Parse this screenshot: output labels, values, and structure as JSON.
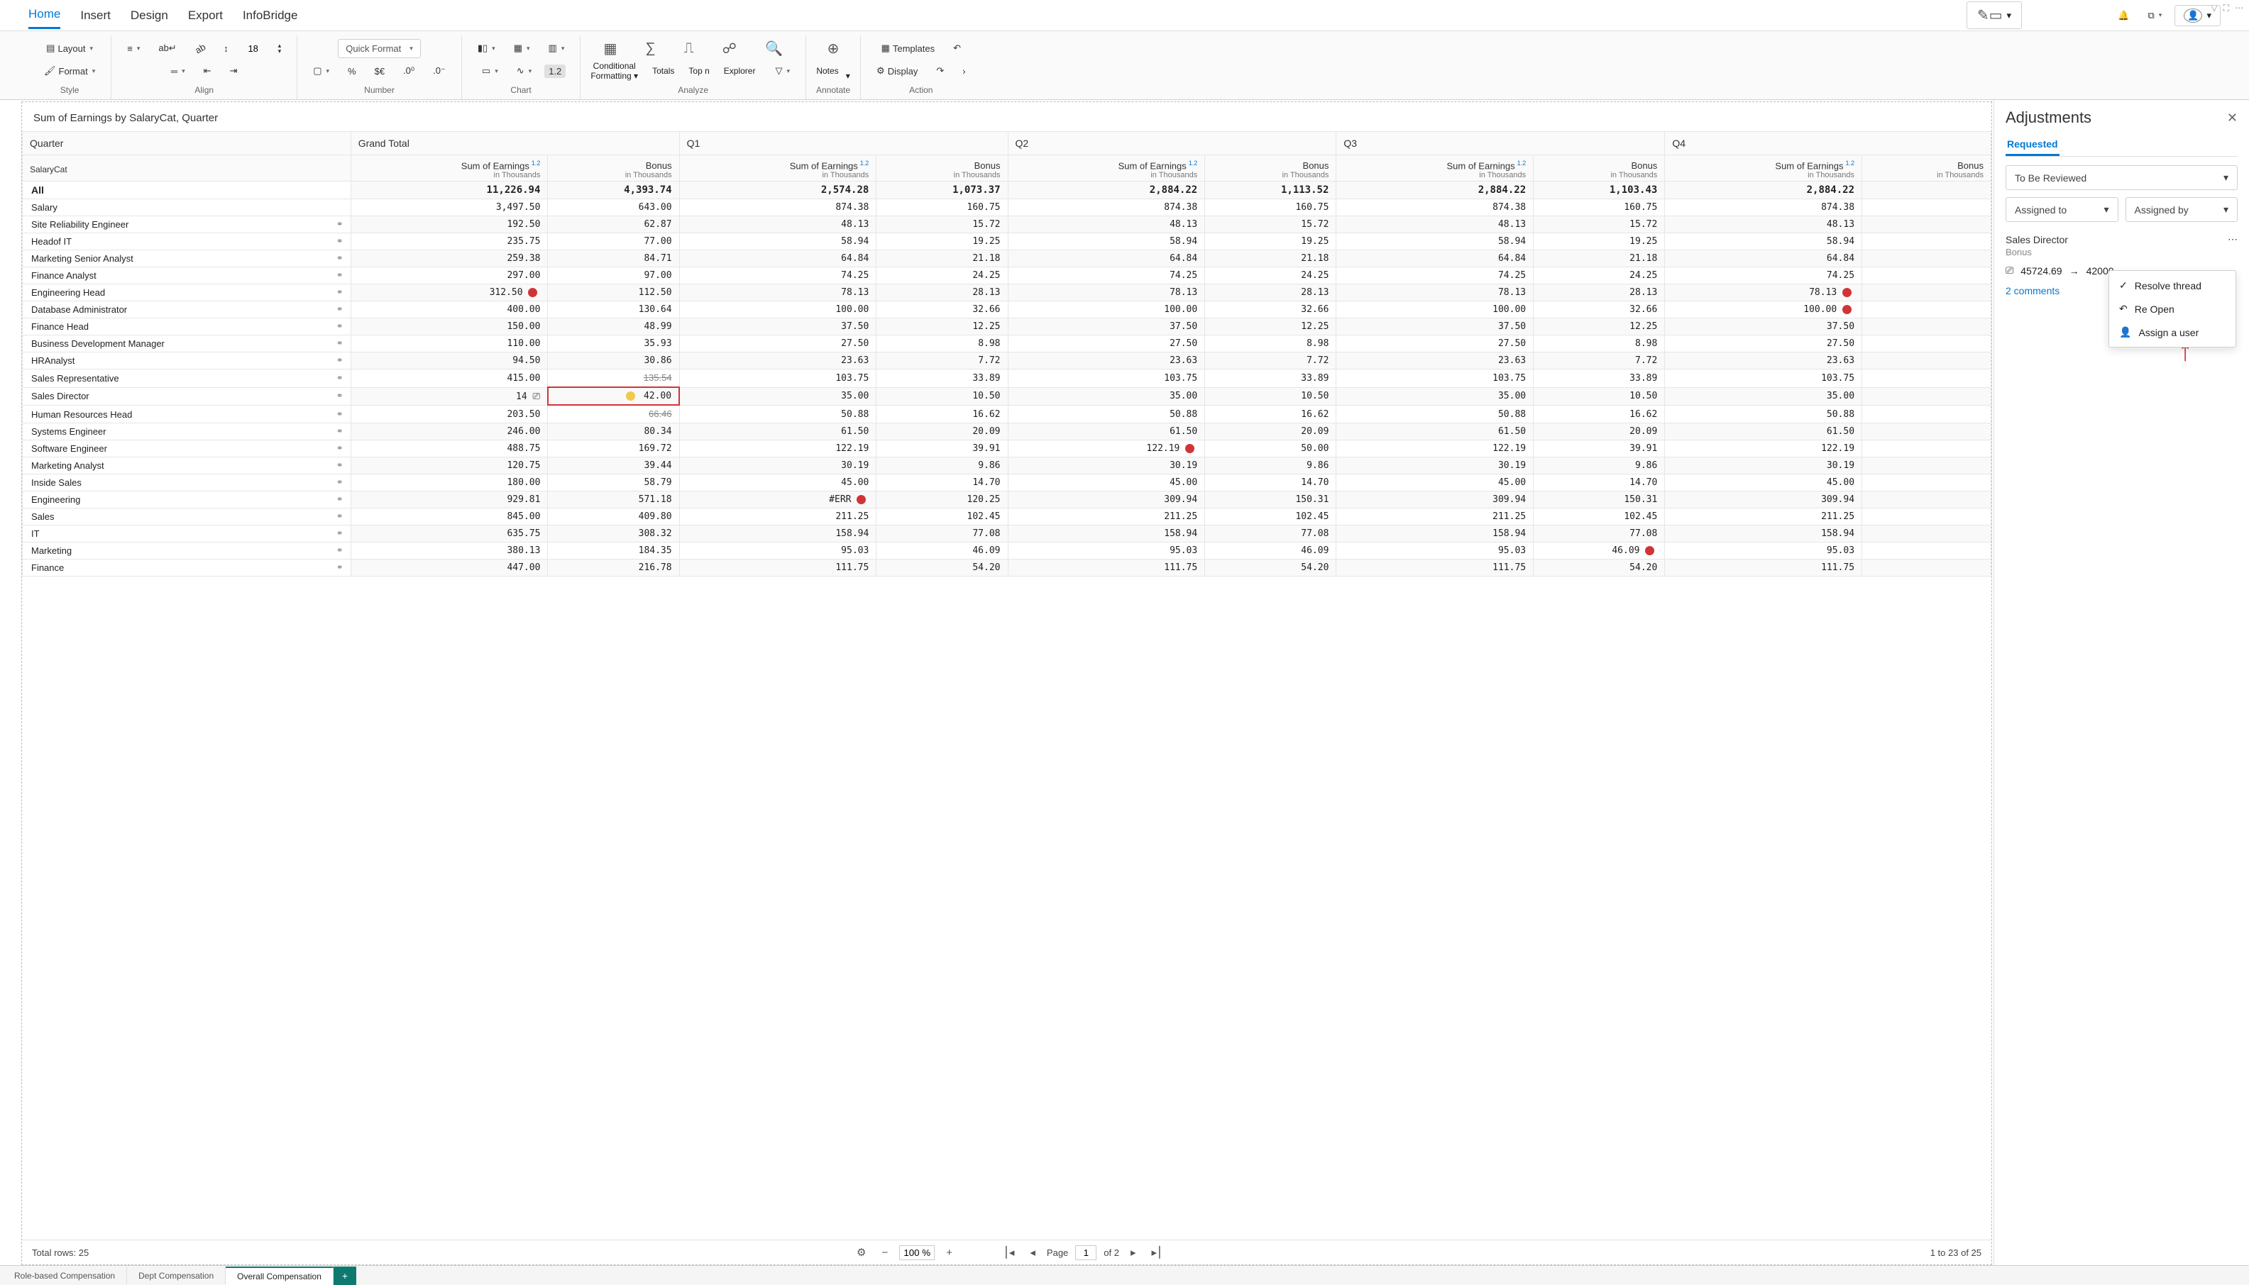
{
  "menu": {
    "items": [
      "Home",
      "Insert",
      "Design",
      "Export",
      "InfoBridge"
    ],
    "active": 0
  },
  "ribbon": {
    "style": {
      "layout": "Layout",
      "format": "Format",
      "label": "Style"
    },
    "align": {
      "fontsize": "18",
      "label": "Align"
    },
    "number": {
      "quickformat": "Quick Format",
      "label": "Number",
      "pct": "%",
      "cur": "$€",
      "d0": ".0⁰",
      "d1": ".0⁻"
    },
    "chart": {
      "label": "Chart",
      "scale": "1.2"
    },
    "analyze": {
      "cond": "Conditional",
      "cond2": "Formatting",
      "totals": "Totals",
      "topn": "Top n",
      "explorer": "Explorer",
      "label": "Analyze"
    },
    "annotate": {
      "notes": "Notes",
      "label": "Annotate"
    },
    "templates": "Templates",
    "display": "Display",
    "actions": "Action"
  },
  "report": {
    "title": "Sum of Earnings by SalaryCat, Quarter",
    "col_quarter": "Quarter",
    "col_cat": "SalaryCat",
    "col_grand": "Grand Total",
    "quarters": [
      "Q1",
      "Q2",
      "Q3",
      "Q4"
    ],
    "sub_earn": "Sum of Earnings",
    "sub_bonus": "Bonus",
    "sub_unit": "in Thousands",
    "sup": "1.2",
    "all_label": "All",
    "rows": [
      {
        "cat": "Salary",
        "link": false,
        "e": "3,497.50",
        "b": "643.00",
        "q": [
          [
            "874.38",
            "160.75"
          ],
          [
            "874.38",
            "160.75"
          ],
          [
            "874.38",
            "160.75"
          ],
          [
            "874.38",
            ""
          ]
        ]
      },
      {
        "cat": "Site Reliability Engineer",
        "link": true,
        "e": "192.50",
        "b": "62.87",
        "q": [
          [
            "48.13",
            "15.72"
          ],
          [
            "48.13",
            "15.72"
          ],
          [
            "48.13",
            "15.72"
          ],
          [
            "48.13",
            ""
          ]
        ]
      },
      {
        "cat": "Headof IT",
        "link": true,
        "e": "235.75",
        "b": "77.00",
        "q": [
          [
            "58.94",
            "19.25"
          ],
          [
            "58.94",
            "19.25"
          ],
          [
            "58.94",
            "19.25"
          ],
          [
            "58.94",
            ""
          ]
        ]
      },
      {
        "cat": "Marketing Senior Analyst",
        "link": true,
        "e": "259.38",
        "b": "84.71",
        "q": [
          [
            "64.84",
            "21.18"
          ],
          [
            "64.84",
            "21.18"
          ],
          [
            "64.84",
            "21.18"
          ],
          [
            "64.84",
            ""
          ]
        ]
      },
      {
        "cat": "Finance Analyst",
        "link": true,
        "e": "297.00",
        "b": "97.00",
        "q": [
          [
            "74.25",
            "24.25"
          ],
          [
            "74.25",
            "24.25"
          ],
          [
            "74.25",
            "24.25"
          ],
          [
            "74.25",
            ""
          ]
        ]
      },
      {
        "cat": "Engineering Head",
        "link": true,
        "e": "312.50",
        "b": "112.50",
        "dotE": "red",
        "q": [
          [
            "78.13",
            "28.13"
          ],
          [
            "78.13",
            "28.13"
          ],
          [
            "78.13",
            "28.13"
          ],
          [
            "78.13",
            ""
          ]
        ],
        "dotQ4": "red"
      },
      {
        "cat": "Database Administrator",
        "link": true,
        "e": "400.00",
        "b": "130.64",
        "q": [
          [
            "100.00",
            "32.66"
          ],
          [
            "100.00",
            "32.66"
          ],
          [
            "100.00",
            "32.66"
          ],
          [
            "100.00",
            ""
          ]
        ],
        "dotQ4": "red"
      },
      {
        "cat": "Finance Head",
        "link": true,
        "e": "150.00",
        "b": "48.99",
        "q": [
          [
            "37.50",
            "12.25"
          ],
          [
            "37.50",
            "12.25"
          ],
          [
            "37.50",
            "12.25"
          ],
          [
            "37.50",
            ""
          ]
        ]
      },
      {
        "cat": "Business Development Manager",
        "link": true,
        "e": "110.00",
        "b": "35.93",
        "q": [
          [
            "27.50",
            "8.98"
          ],
          [
            "27.50",
            "8.98"
          ],
          [
            "27.50",
            "8.98"
          ],
          [
            "27.50",
            ""
          ]
        ]
      },
      {
        "cat": "HRAnalyst",
        "link": true,
        "e": "94.50",
        "b": "30.86",
        "q": [
          [
            "23.63",
            "7.72"
          ],
          [
            "23.63",
            "7.72"
          ],
          [
            "23.63",
            "7.72"
          ],
          [
            "23.63",
            ""
          ]
        ]
      },
      {
        "cat": "Sales Representative",
        "link": true,
        "e": "415.00",
        "b": "135.54",
        "bStrike": true,
        "q": [
          [
            "103.75",
            "33.89"
          ],
          [
            "103.75",
            "33.89"
          ],
          [
            "103.75",
            "33.89"
          ],
          [
            "103.75",
            ""
          ]
        ]
      },
      {
        "cat": "Sales Director",
        "link": true,
        "e": "14",
        "eIcon": true,
        "b": "42.00",
        "bHighlight": true,
        "dotB": "yellow",
        "q": [
          [
            "35.00",
            "10.50"
          ],
          [
            "35.00",
            "10.50"
          ],
          [
            "35.00",
            "10.50"
          ],
          [
            "35.00",
            ""
          ]
        ]
      },
      {
        "cat": "Human Resources Head",
        "link": true,
        "e": "203.50",
        "b": "66.46",
        "bStrike": true,
        "q": [
          [
            "50.88",
            "16.62"
          ],
          [
            "50.88",
            "16.62"
          ],
          [
            "50.88",
            "16.62"
          ],
          [
            "50.88",
            ""
          ]
        ]
      },
      {
        "cat": "Systems Engineer",
        "link": true,
        "e": "246.00",
        "b": "80.34",
        "q": [
          [
            "61.50",
            "20.09"
          ],
          [
            "61.50",
            "20.09"
          ],
          [
            "61.50",
            "20.09"
          ],
          [
            "61.50",
            ""
          ]
        ]
      },
      {
        "cat": "Software Engineer",
        "link": true,
        "e": "488.75",
        "b": "169.72",
        "q": [
          [
            "122.19",
            "39.91"
          ],
          [
            "122.19",
            "50.00"
          ],
          [
            "122.19",
            "39.91"
          ],
          [
            "122.19",
            ""
          ]
        ],
        "dot_q2e": "red"
      },
      {
        "cat": "Marketing Analyst",
        "link": true,
        "e": "120.75",
        "b": "39.44",
        "q": [
          [
            "30.19",
            "9.86"
          ],
          [
            "30.19",
            "9.86"
          ],
          [
            "30.19",
            "9.86"
          ],
          [
            "30.19",
            ""
          ]
        ]
      },
      {
        "cat": "Inside Sales",
        "link": true,
        "e": "180.00",
        "b": "58.79",
        "q": [
          [
            "45.00",
            "14.70"
          ],
          [
            "45.00",
            "14.70"
          ],
          [
            "45.00",
            "14.70"
          ],
          [
            "45.00",
            ""
          ]
        ]
      },
      {
        "cat": "Engineering",
        "link": true,
        "e": "929.81",
        "b": "571.18",
        "q": [
          [
            "#ERR",
            "120.25"
          ],
          [
            "309.94",
            "150.31"
          ],
          [
            "309.94",
            "150.31"
          ],
          [
            "309.94",
            ""
          ]
        ],
        "dot_q1e": "red"
      },
      {
        "cat": "Sales",
        "link": true,
        "e": "845.00",
        "b": "409.80",
        "q": [
          [
            "211.25",
            "102.45"
          ],
          [
            "211.25",
            "102.45"
          ],
          [
            "211.25",
            "102.45"
          ],
          [
            "211.25",
            ""
          ]
        ]
      },
      {
        "cat": "IT",
        "link": true,
        "e": "635.75",
        "b": "308.32",
        "q": [
          [
            "158.94",
            "77.08"
          ],
          [
            "158.94",
            "77.08"
          ],
          [
            "158.94",
            "77.08"
          ],
          [
            "158.94",
            ""
          ]
        ]
      },
      {
        "cat": "Marketing",
        "link": true,
        "e": "380.13",
        "b": "184.35",
        "q": [
          [
            "95.03",
            "46.09"
          ],
          [
            "95.03",
            "46.09"
          ],
          [
            "95.03",
            "46.09"
          ],
          [
            "95.03",
            ""
          ]
        ],
        "dot_q3b": "red"
      },
      {
        "cat": "Finance",
        "link": true,
        "e": "447.00",
        "b": "216.78",
        "q": [
          [
            "111.75",
            "54.20"
          ],
          [
            "111.75",
            "54.20"
          ],
          [
            "111.75",
            "54.20"
          ],
          [
            "111.75",
            ""
          ]
        ]
      }
    ],
    "all": {
      "e": "11,226.94",
      "b": "4,393.74",
      "q": [
        [
          "2,574.28",
          "1,073.37"
        ],
        [
          "2,884.22",
          "1,113.52"
        ],
        [
          "2,884.22",
          "1,103.43"
        ],
        [
          "2,884.22",
          ""
        ]
      ]
    }
  },
  "footer": {
    "total_rows": "Total rows: 25",
    "zoom": "100 %",
    "page_lbl": "Page",
    "page_val": "1",
    "page_of": "of 2",
    "range": "1  to  23  of  25"
  },
  "tabs": {
    "items": [
      "Role-based Compensation",
      "Dept Compensation",
      "Overall Compensation"
    ],
    "active": 2
  },
  "panel": {
    "title": "Adjustments",
    "tab": "Requested",
    "status_sel": "To Be Reviewed",
    "assigned_to": "Assigned to",
    "assigned_by": "Assigned by",
    "card_title": "Sales Director",
    "card_sub": "Bonus",
    "old_val": "45724.69",
    "new_val": "42000",
    "comments": "2 comments",
    "menu": {
      "resolve": "Resolve thread",
      "reopen": "Re Open",
      "assign": "Assign a user"
    }
  }
}
